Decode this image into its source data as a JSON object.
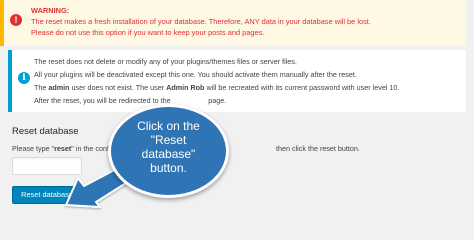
{
  "warning": {
    "icon": "exclamation-icon",
    "title": "WARNING:",
    "line1": "The reset makes a fresh installation of your database. Therefore, ANY data in your database will be lost.",
    "line2": "Please do not use this option if you want to keep your posts and pages."
  },
  "info": {
    "icon": "info-icon",
    "line1": "The reset does not delete or modify any of your plugins/themes files or server files.",
    "line2": "All your plugins will be deactivated except this one. You should activate them manually after the reset.",
    "line3_pre": "The ",
    "line3_bold1": "admin",
    "line3_mid": " user does not exist. The user ",
    "line3_bold2": "Admin Rob",
    "line3_post": " will be recreated with its current password with user level 10.",
    "line4_pre": "After the reset, you will be redirected to the",
    "line4_post": "page."
  },
  "reset": {
    "title": "Reset database",
    "desc_pre": "Please type \"",
    "desc_keyword": "reset",
    "desc_post": "\" in the confirmation",
    "desc_right": "then click the reset button.",
    "input_value": "",
    "button_label": "Reset database"
  },
  "callout": {
    "line1": "Click on the",
    "line2": "\"Reset",
    "line3": "database\"",
    "line4": "button.",
    "color": "#2f75b5"
  }
}
